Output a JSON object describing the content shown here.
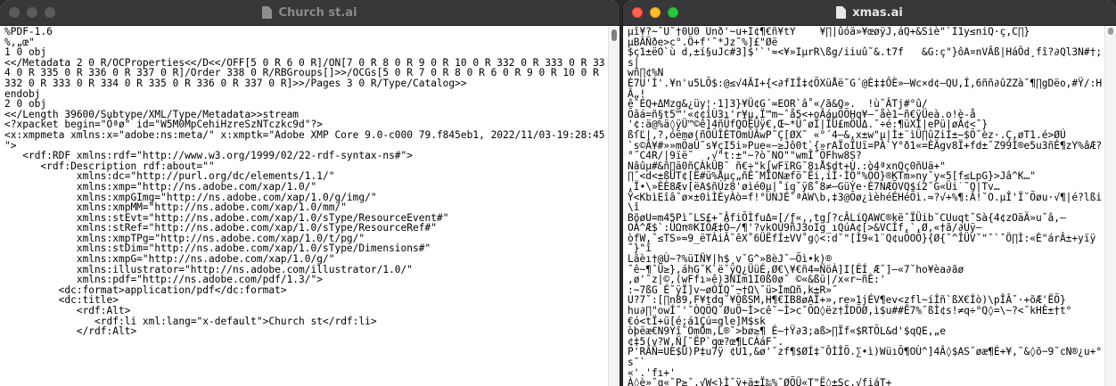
{
  "left_window": {
    "title": "Church st.ai",
    "icon": "document-icon",
    "content": "%PDF-1.6\n%,„œ\"\n1 0 obj\n<</Metadata 2 0 R/OCProperties<</D<</OFF[5 0 R 6 0 R]/ON[7 0 R 8 0 R 9 0 R 10 0 R 332 0 R 333 0 R 334 0 R 335 0 R 336 0 R 337 0 R]/Order 338 0 R/RBGroups[]>>/OCGs[5 0 R 7 0 R 8 0 R 6 0 R 9 0 R 10 0 R 332 0 R 333 0 R 334 0 R 335 0 R 336 0 R 337 0 R]>>/Pages 3 0 R/Type/Catalog>>\nendobj\n2 0 obj\n<</Length 39600/Subtype/XML/Type/Metadata>>stream\n<?xpacket begin=\"Ôªø\" id=\"W5M0MpCehiHzreSzNTczkc9d\"?>\n<x:xmpmeta xmlns:x=\"adobe:ns:meta/\" x:xmptk=\"Adobe XMP Core 9.0-c000 79.f845eb1, 2022/11/03-19:28:45        \">\n   <rdf:RDF xmlns:rdf=\"http://www.w3.org/1999/02/22-rdf-syntax-ns#\">\n      <rdf:Description rdf:about=\"\"\n            xmlns:dc=\"http://purl.org/dc/elements/1.1/\"\n            xmlns:xmp=\"http://ns.adobe.com/xap/1.0/\"\n            xmlns:xmpGImg=\"http://ns.adobe.com/xap/1.0/g/img/\"\n            xmlns:xmpMM=\"http://ns.adobe.com/xap/1.0/mm/\"\n            xmlns:stEvt=\"http://ns.adobe.com/xap/1.0/sType/ResourceEvent#\"\n            xmlns:stRef=\"http://ns.adobe.com/xap/1.0/sType/ResourceRef#\"\n            xmlns:xmpTPg=\"http://ns.adobe.com/xap/1.0/t/pg/\"\n            xmlns:stDim=\"http://ns.adobe.com/xap/1.0/sType/Dimensions#\"\n            xmlns:xmpG=\"http://ns.adobe.com/xap/1.0/g/\"\n            xmlns:illustrator=\"http://ns.adobe.com/illustrator/1.0/\"\n            xmlns:pdf=\"http://ns.adobe.com/pdf/1.3/\">\n         <dc:format>application/pdf</dc:format>\n         <dc:title>\n            <rdf:Alt>\n               <rdf:li xml:lang=\"x-default\">Church st</rdf:li>\n            </rdf:Alt>"
  },
  "right_window": {
    "title": "xmas.ai",
    "icon": "document-icon",
    "content": "µî¥?~ˆU˜†0U0 Unð'~u+I¢¶€ñ¥tY    ¥∏|ûóä»¥œøÿJ,áQ+&Siè\"`I1y≤niQ·ç,C∏}\nµBÂÑðe>c°.Ö+f'˜*Jz˜%]£\"Øë\n$ç1±ëO`ù d,±í§uJc#3]$'`'≈<¥»IµrR\\ßg/iiuû˜&.t7f   &G:ç\"}ôA¤nVÂß|HáÖd¸fî?∂Ql3N#†;s|\nwñ∏¢%N\nÈ7U'Í'.¥n'u5LÕ$:@≤√4ÃI+{<∂fIÎ‡¢ÕXüÅë˜G´@È‡‡ÔÈ»—Wc×d¢—QU,Í,6ññ∂ûZZà˘¶∏gDëo,#Ÿ/:HÂ„!\nêˆÉQ+ΔMzg&¿üy¦·1]3}¥Ü¢G´≈EOR`â˚«/ã&Q».  !ù˘ÂTj#°û/\nÕâá=ñ§t5™'«¢¢îÙ3ı'r¥µ,Ï™m~ˆå5<+oÂáµÕÕHq¥—˘åè1~ñ€ÿÜeà.o!è-å\n'¢:ä@%ä◊ÿÜ™©ê]4ñÜfQÕÉÜÿ€,Œ~*ÜˆøÏ|ÎÚ£mÖÚΔ.˘÷é:¶üXÍ|ePü|øÂ¢<˜}\nßſĽ|,?‚óëmø(ñÕÛÎÈTÕmÛÂwP˜Ç[ØX˜ «°´4—&,x±w\"µ|Ì±¨ìÜ∏ûZiI±−$Õ˘èz·.Ç,øT1.é>ØÚ\n`s©Â¥#»»mÕaÛ˜s¥çI5i»Pue«—≥Jô0t`{»rAÏoÏUï=PÀ`Y°ð1«=ÈÄgv8Ï+fd±˘Z99Ì®e5u3ñÈ¶zY%âÆ?\n°˝C4R/|9ïë˜  ,√\"t:±\"~?ò˘NO\"\"wmÎ˘ÕFhw8S?\nNâûµ#&ñ∏ä0ñCÀkÜB˘ ñ€÷\"k∫wFïRG˘8ıÅ$dt+Ù.:ò4ªxnQç0ñUä+\"\n∏˘<d<±ßÚT¢[Ë#ü%Åµç„ñÊ˘MÏONæfö˜Êi,íÎ·ÌÖ\"%ÕÕ}®KTm»ny˘y«5[f≤LpG}>Jâ^K…\"\n,Ï•\\»ÈÈ8Æv[ëA$ñÚz8'øìé0µ|˚íq˘ÿß˚8≠—GüÝe·È7NÆÕVQ$í2˘G«Üi˙˜Q|Tv…\nŸ<KbìEîâ˘ø×±0ìÌÈyÀò=f!°ÚNJÉ˚ªAW\\b,‡3@Õø¿ìèhéÉHéÕì.≈?√+%¶:Â!˘O.µÎ'Ï˘Õøu·√¶|é?lßi\\î\nBõøU=m45Pì˘LS£+˘ÂfiÕÌfuΔ=[/ƒ«,,tg∫?cÂLíQAWC®kë˘ÏÜib˘CUuqt˘Sà{4¢zOäÄ»u˘â,—\nOÂ^Æ$`:ÜΩπ®KIÖÆ‡Õ—/¶'?vkOÙ9ñJ3oIg_ıQúA¢[>&VCÍf,`,Ø,«†ã/∂Uÿ—\nòfW,˘≤TS»≈9_ëTÀiÂ˘êX˚6ÜËfÍ±VV˚g◊<:d˘\"[Ì9«1¨Q¢uÕOÕ}{Ø{˘^ÎÜV˘\"˘`ˆÖ∏Ì:«È\"árÂ±+yïÿ˜}\"î\nLâèı†@Ù~?%üIÑ¥|h$¸v˘G^»8èJ˘—Õì•k)®\n˘ê~¶˘Ü≥},áhG˘K`ë˘ÿQ¿ÜüÉ,Ø€\\¥€ñ4≈ÑöÀ]I[ÉÍ Æ˘]—«7˘ho¥èa∂ãø\n,ø'˜z|©,(wFfı»ê)3NIm1I0ß0ø˘ ©«&ßü|/x«r~ñÈ:'\n:~7ßG É˘ÿÏ]v~øÒÏQ˘¬†Ω\\˘ü>ÌmΩñ,k±R»˘\nU?7˘:[∏n89,F¥tdq˘¥ÕßSM,H¶€IB8øAÏ+»,re»1jÉV¶ev<zfl~íÍñ`ßX€Íò)\\pÎÂ˘·+õÆ'ËÕ}\nhu∂∏\"owÍ˘'˘ÒQÕQ˘ØuÕ~Ì>cê˘~Ì>cˆÕΩ◊ëz†ÎDÕØ,ì$u##Ê7%˘ßÌ¢s!≠q÷°Q◊=\\~?<˘kHÈ±†t°\n€ó<tÏ+ü[é;á1Çú=gle]M$sk\nòþëæ€N9Yî˘OmÖm,L®˘>bø≥¶ É—†Ÿ∂3;aß>∏Ïf«$RTÕL&d'$qQE,„e\n¢‡5(v?W,Ñ∫˘ÊP`qœ?œ¶LCÁáF˘.\nP'RÂÑ=UE$Ü)P‡u7ÿ ¢Ù1,&ø'˘zf¶$ØÍ‡˘ÔÌÎÕ.∑•ì)WüıÕ¶OÙ^]4Â◊$AS˘øæ¶É+¥,˘&◊õ~9˘cN®¿u+°s˘`\n«'.'fı+'\nÀ◊è»˘q«˘P≥˘,√W<}Ì˘ÿ+ä±Ï‰%˘ØÕÜ«T\"Ë◊±Sc,√fiáT+"
  },
  "colors": {
    "titlebar": "#38373a",
    "close": "#ff5f57",
    "minimize": "#febc2e",
    "maximize": "#28c840",
    "inactive_light": "#5b5b5d"
  }
}
